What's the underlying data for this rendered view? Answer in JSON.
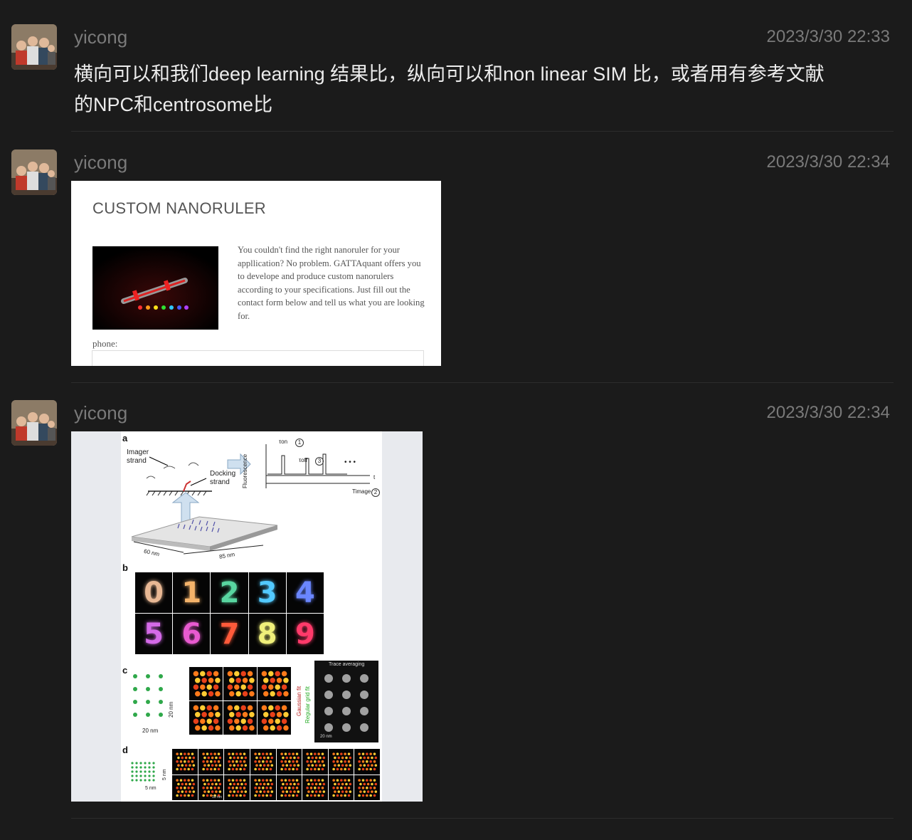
{
  "messages": [
    {
      "user": "yicong",
      "time": "2023/3/30 22:33",
      "text_line1": "横向可以和我们deep learning 结果比，纵向可以和non linear SIM 比，或者用有参考文献",
      "text_line2": "的NPC和centrosome比"
    },
    {
      "user": "yicong",
      "time": "2023/3/30 22:34",
      "image": {
        "title": "CUSTOM NANORULER",
        "description": "You couldn't find the right nanoruler for your appllication? No problem. GATTAquant offers you to develope and produce custom nanorulers according to your specifications. Just fill out the contact form below and tell us what you are looking for.",
        "phone_label": "phone:"
      }
    },
    {
      "user": "yicong",
      "time": "2023/3/30 22:34",
      "figure": {
        "panel_a": "a",
        "panel_b": "b",
        "panel_c": "c",
        "panel_d": "d",
        "imager_strand": "Imager strand",
        "docking_strand": "Docking strand",
        "fluorescence": "Fluorescence",
        "t_on": "τon",
        "t_off": "τoff",
        "t_image": "Timage",
        "t_axis": "t",
        "dim_60": "60 nm",
        "dim_85": "85 nm",
        "digits": [
          "0",
          "1",
          "2",
          "3",
          "4",
          "5",
          "6",
          "7",
          "8",
          "9"
        ],
        "digit_colors": [
          "#e8b894",
          "#f4b36a",
          "#58d6a0",
          "#52c9ff",
          "#6a86ff",
          "#d46ae8",
          "#e85ad0",
          "#ff5a3a",
          "#f0f07a",
          "#ff3a6a"
        ],
        "dim_20nm_v": "20 nm",
        "dim_20nm_h": "20 nm",
        "gaussian_fit": "Gaussian fit",
        "regular_grid_fit": "Regular grid fit",
        "trace_averaging": "Trace averaging",
        "scale_20nm": "20 nm",
        "dim_5nm_v": "5 nm",
        "dim_5nm_h": "5 nm",
        "scale_10nm": "10 nm",
        "circle_1": "1",
        "circle_2": "2",
        "circle_3": "3",
        "dots": "• • •"
      }
    }
  ]
}
